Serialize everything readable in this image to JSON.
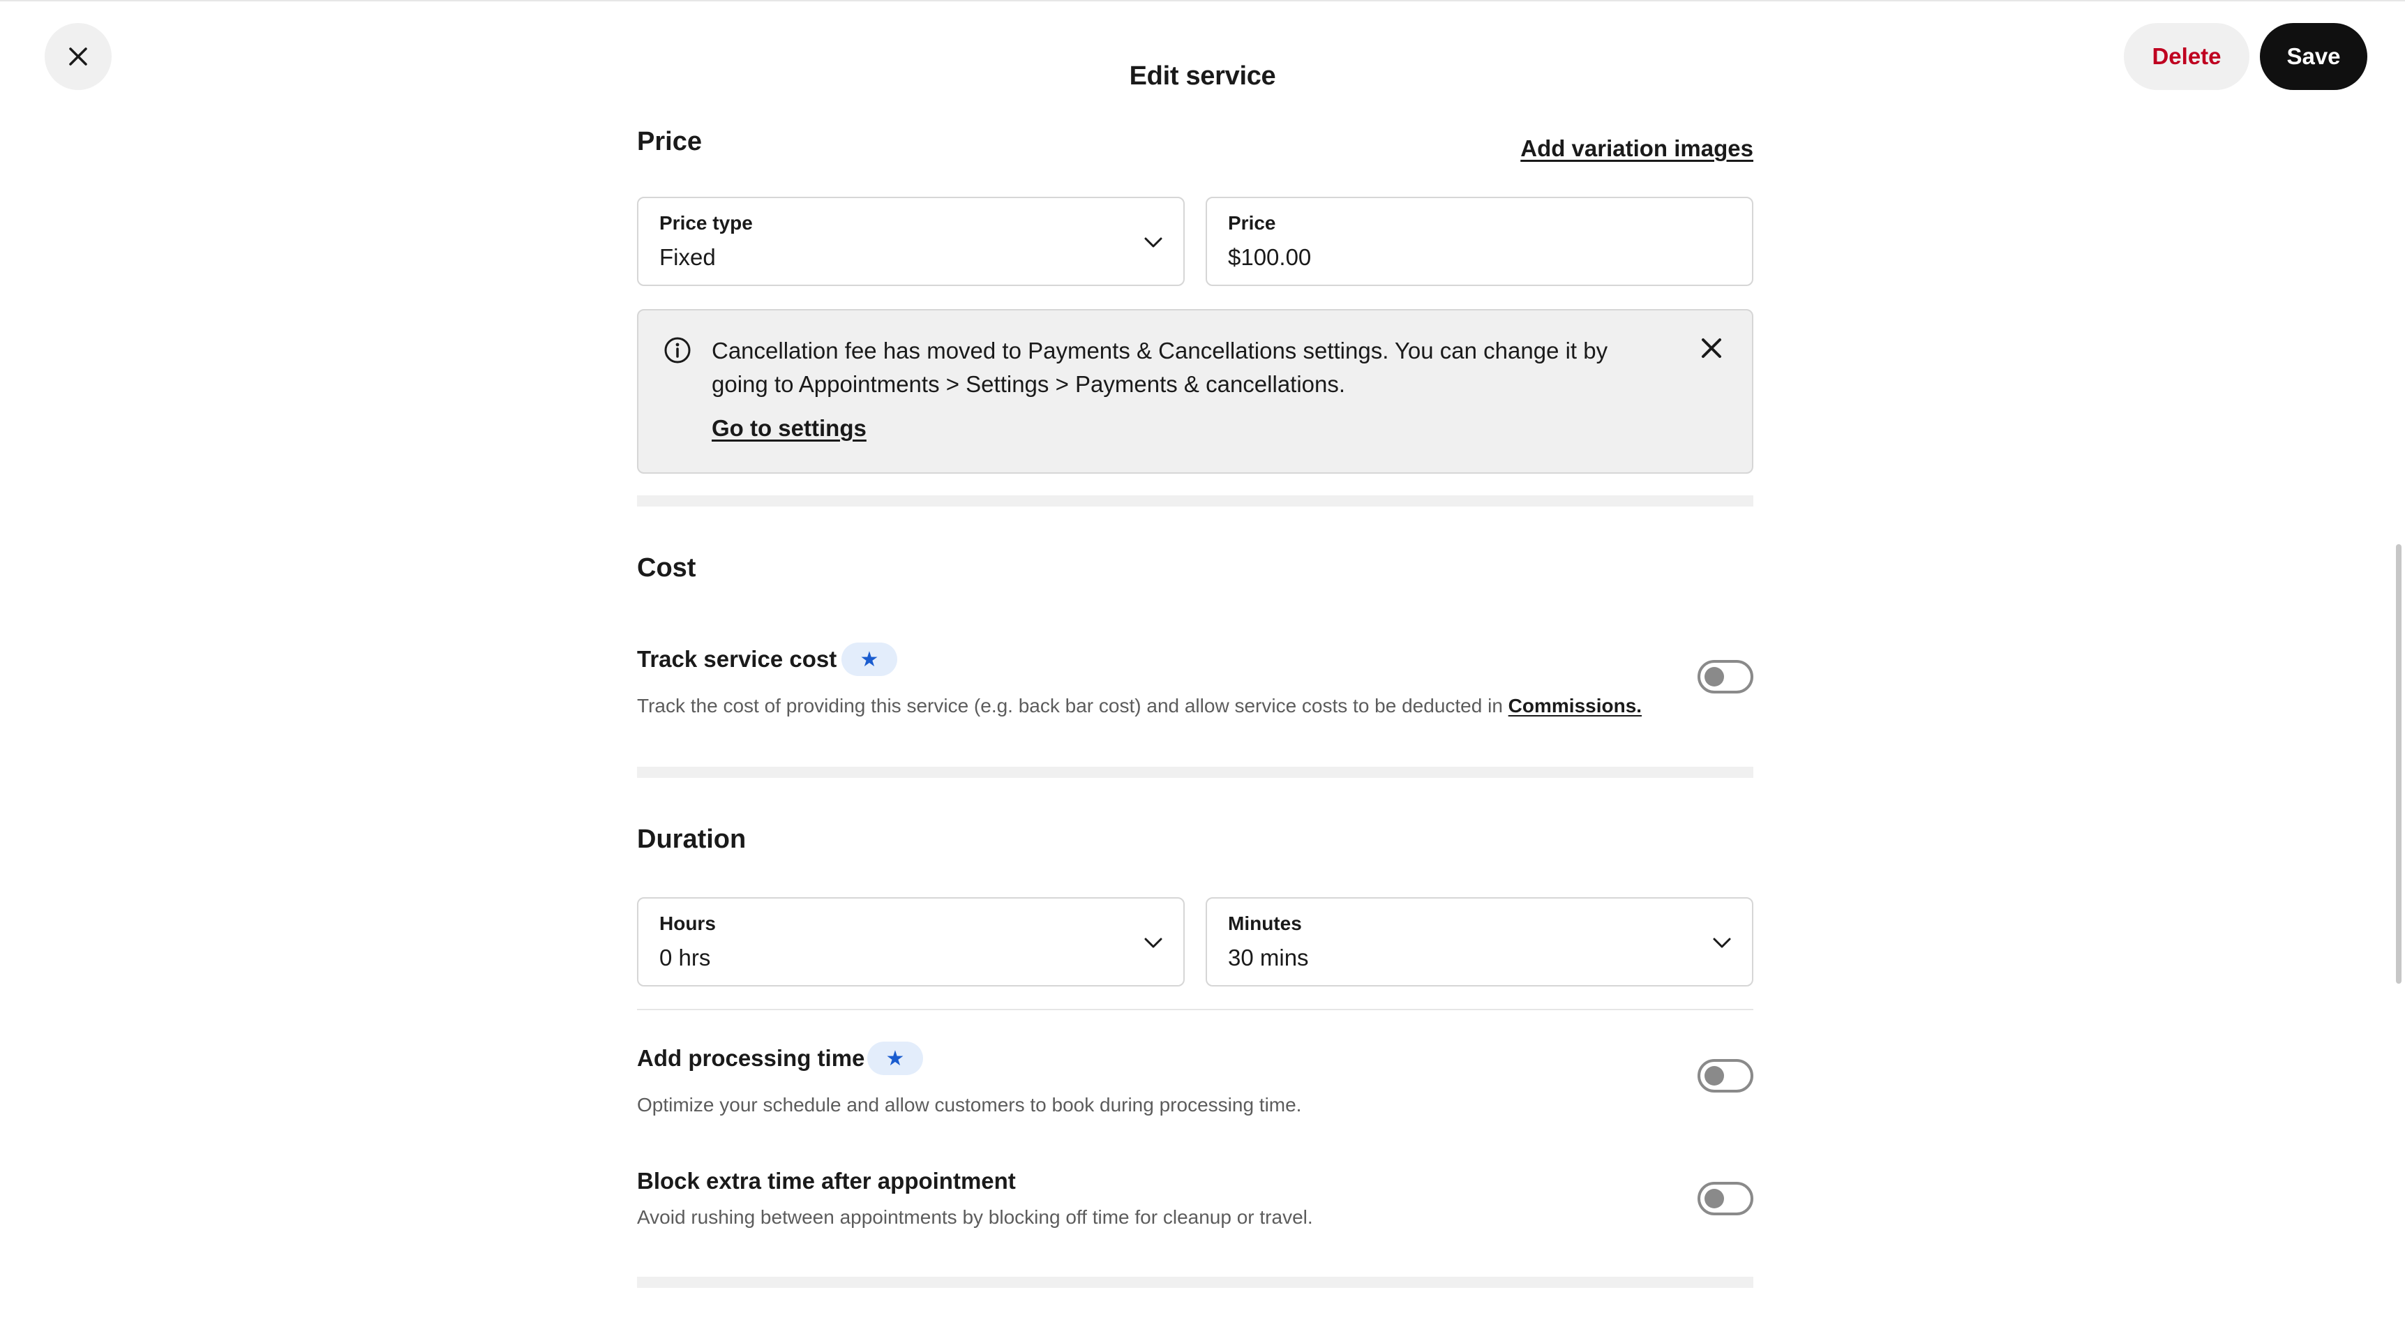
{
  "header": {
    "title": "Edit service",
    "delete_label": "Delete",
    "save_label": "Save",
    "close_icon": "close-icon"
  },
  "price_section": {
    "title": "Price",
    "add_variation_images": "Add variation images",
    "price_type": {
      "label": "Price type",
      "value": "Fixed"
    },
    "price": {
      "label": "Price",
      "value": "$100.00"
    },
    "banner": {
      "text": "Cancellation fee has moved to Payments & Cancellations settings. You can change it by going to Appointments > Settings > Payments & cancellations.",
      "link": "Go to settings"
    }
  },
  "cost_section": {
    "title": "Cost",
    "track_cost": {
      "title": "Track service cost",
      "badge_icon": "star-icon",
      "desc": "Track the cost of providing this service (e.g. back bar cost) and allow service costs to be deducted in",
      "desc_link": "Commissions.",
      "enabled": false
    }
  },
  "duration_section": {
    "title": "Duration",
    "hours": {
      "label": "Hours",
      "value": "0 hrs"
    },
    "minutes": {
      "label": "Minutes",
      "value": "30 mins"
    },
    "processing_time": {
      "title": "Add processing time",
      "badge_icon": "star-icon",
      "desc": "Optimize your schedule and allow customers to book during processing time.",
      "enabled": false
    },
    "extra_time": {
      "title": "Block extra time after appointment",
      "desc": "Avoid rushing between appointments by blocking off time for cleanup or travel.",
      "enabled": false
    }
  },
  "colors": {
    "primary": "#101010",
    "danger": "#bf0020",
    "badge_bg": "#e3edfb",
    "badge_fg": "#1a5ccf",
    "muted_text": "#5c5c5c",
    "surface": "#f0f0f0"
  }
}
